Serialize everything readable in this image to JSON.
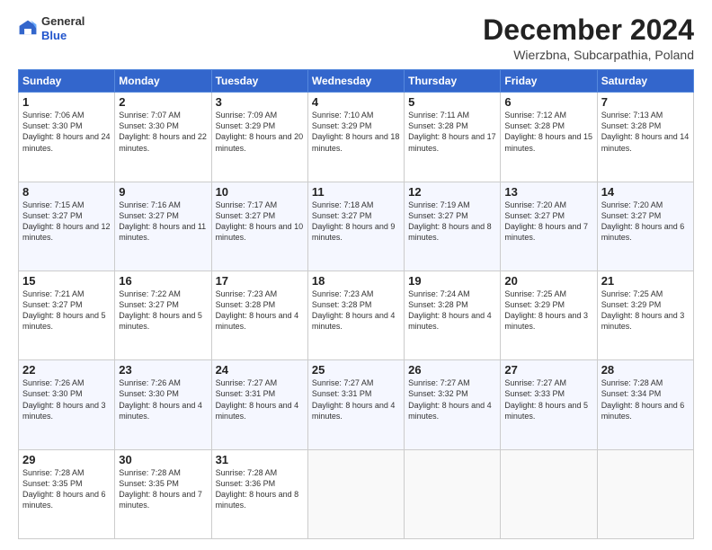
{
  "header": {
    "logo": {
      "line1": "General",
      "line2": "Blue"
    },
    "title": "December 2024",
    "location": "Wierzbna, Subcarpathia, Poland"
  },
  "days_of_week": [
    "Sunday",
    "Monday",
    "Tuesday",
    "Wednesday",
    "Thursday",
    "Friday",
    "Saturday"
  ],
  "weeks": [
    [
      {
        "day": "1",
        "sunrise": "Sunrise: 7:06 AM",
        "sunset": "Sunset: 3:30 PM",
        "daylight": "Daylight: 8 hours and 24 minutes."
      },
      {
        "day": "2",
        "sunrise": "Sunrise: 7:07 AM",
        "sunset": "Sunset: 3:30 PM",
        "daylight": "Daylight: 8 hours and 22 minutes."
      },
      {
        "day": "3",
        "sunrise": "Sunrise: 7:09 AM",
        "sunset": "Sunset: 3:29 PM",
        "daylight": "Daylight: 8 hours and 20 minutes."
      },
      {
        "day": "4",
        "sunrise": "Sunrise: 7:10 AM",
        "sunset": "Sunset: 3:29 PM",
        "daylight": "Daylight: 8 hours and 18 minutes."
      },
      {
        "day": "5",
        "sunrise": "Sunrise: 7:11 AM",
        "sunset": "Sunset: 3:28 PM",
        "daylight": "Daylight: 8 hours and 17 minutes."
      },
      {
        "day": "6",
        "sunrise": "Sunrise: 7:12 AM",
        "sunset": "Sunset: 3:28 PM",
        "daylight": "Daylight: 8 hours and 15 minutes."
      },
      {
        "day": "7",
        "sunrise": "Sunrise: 7:13 AM",
        "sunset": "Sunset: 3:28 PM",
        "daylight": "Daylight: 8 hours and 14 minutes."
      }
    ],
    [
      {
        "day": "8",
        "sunrise": "Sunrise: 7:15 AM",
        "sunset": "Sunset: 3:27 PM",
        "daylight": "Daylight: 8 hours and 12 minutes."
      },
      {
        "day": "9",
        "sunrise": "Sunrise: 7:16 AM",
        "sunset": "Sunset: 3:27 PM",
        "daylight": "Daylight: 8 hours and 11 minutes."
      },
      {
        "day": "10",
        "sunrise": "Sunrise: 7:17 AM",
        "sunset": "Sunset: 3:27 PM",
        "daylight": "Daylight: 8 hours and 10 minutes."
      },
      {
        "day": "11",
        "sunrise": "Sunrise: 7:18 AM",
        "sunset": "Sunset: 3:27 PM",
        "daylight": "Daylight: 8 hours and 9 minutes."
      },
      {
        "day": "12",
        "sunrise": "Sunrise: 7:19 AM",
        "sunset": "Sunset: 3:27 PM",
        "daylight": "Daylight: 8 hours and 8 minutes."
      },
      {
        "day": "13",
        "sunrise": "Sunrise: 7:20 AM",
        "sunset": "Sunset: 3:27 PM",
        "daylight": "Daylight: 8 hours and 7 minutes."
      },
      {
        "day": "14",
        "sunrise": "Sunrise: 7:20 AM",
        "sunset": "Sunset: 3:27 PM",
        "daylight": "Daylight: 8 hours and 6 minutes."
      }
    ],
    [
      {
        "day": "15",
        "sunrise": "Sunrise: 7:21 AM",
        "sunset": "Sunset: 3:27 PM",
        "daylight": "Daylight: 8 hours and 5 minutes."
      },
      {
        "day": "16",
        "sunrise": "Sunrise: 7:22 AM",
        "sunset": "Sunset: 3:27 PM",
        "daylight": "Daylight: 8 hours and 5 minutes."
      },
      {
        "day": "17",
        "sunrise": "Sunrise: 7:23 AM",
        "sunset": "Sunset: 3:28 PM",
        "daylight": "Daylight: 8 hours and 4 minutes."
      },
      {
        "day": "18",
        "sunrise": "Sunrise: 7:23 AM",
        "sunset": "Sunset: 3:28 PM",
        "daylight": "Daylight: 8 hours and 4 minutes."
      },
      {
        "day": "19",
        "sunrise": "Sunrise: 7:24 AM",
        "sunset": "Sunset: 3:28 PM",
        "daylight": "Daylight: 8 hours and 4 minutes."
      },
      {
        "day": "20",
        "sunrise": "Sunrise: 7:25 AM",
        "sunset": "Sunset: 3:29 PM",
        "daylight": "Daylight: 8 hours and 3 minutes."
      },
      {
        "day": "21",
        "sunrise": "Sunrise: 7:25 AM",
        "sunset": "Sunset: 3:29 PM",
        "daylight": "Daylight: 8 hours and 3 minutes."
      }
    ],
    [
      {
        "day": "22",
        "sunrise": "Sunrise: 7:26 AM",
        "sunset": "Sunset: 3:30 PM",
        "daylight": "Daylight: 8 hours and 3 minutes."
      },
      {
        "day": "23",
        "sunrise": "Sunrise: 7:26 AM",
        "sunset": "Sunset: 3:30 PM",
        "daylight": "Daylight: 8 hours and 4 minutes."
      },
      {
        "day": "24",
        "sunrise": "Sunrise: 7:27 AM",
        "sunset": "Sunset: 3:31 PM",
        "daylight": "Daylight: 8 hours and 4 minutes."
      },
      {
        "day": "25",
        "sunrise": "Sunrise: 7:27 AM",
        "sunset": "Sunset: 3:31 PM",
        "daylight": "Daylight: 8 hours and 4 minutes."
      },
      {
        "day": "26",
        "sunrise": "Sunrise: 7:27 AM",
        "sunset": "Sunset: 3:32 PM",
        "daylight": "Daylight: 8 hours and 4 minutes."
      },
      {
        "day": "27",
        "sunrise": "Sunrise: 7:27 AM",
        "sunset": "Sunset: 3:33 PM",
        "daylight": "Daylight: 8 hours and 5 minutes."
      },
      {
        "day": "28",
        "sunrise": "Sunrise: 7:28 AM",
        "sunset": "Sunset: 3:34 PM",
        "daylight": "Daylight: 8 hours and 6 minutes."
      }
    ],
    [
      {
        "day": "29",
        "sunrise": "Sunrise: 7:28 AM",
        "sunset": "Sunset: 3:35 PM",
        "daylight": "Daylight: 8 hours and 6 minutes."
      },
      {
        "day": "30",
        "sunrise": "Sunrise: 7:28 AM",
        "sunset": "Sunset: 3:35 PM",
        "daylight": "Daylight: 8 hours and 7 minutes."
      },
      {
        "day": "31",
        "sunrise": "Sunrise: 7:28 AM",
        "sunset": "Sunset: 3:36 PM",
        "daylight": "Daylight: 8 hours and 8 minutes."
      },
      null,
      null,
      null,
      null
    ]
  ]
}
